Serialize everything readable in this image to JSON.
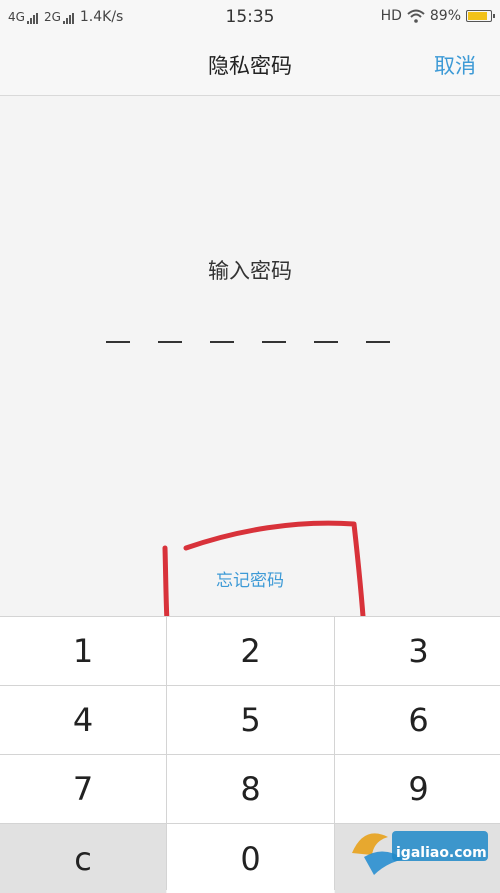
{
  "status_bar": {
    "net1_label": "4G",
    "net2_label": "2G",
    "speed": "1.4K/s",
    "time": "15:35",
    "hd_label": "HD",
    "battery_text": "89%",
    "battery_level_percent": 89,
    "battery_color": "#f2c21a"
  },
  "header": {
    "title": "隐私密码",
    "cancel_label": "取消"
  },
  "main": {
    "prompt": "输入密码",
    "pin_length": 6,
    "forgot_label": "忘记密码"
  },
  "keypad": {
    "keys": [
      "1",
      "2",
      "3",
      "4",
      "5",
      "6",
      "7",
      "8",
      "9",
      "c",
      "0",
      ""
    ]
  },
  "watermark": {
    "text": "igaliao.com"
  },
  "colors": {
    "accent": "#3d9ad6",
    "annotation": "#d8323a"
  }
}
